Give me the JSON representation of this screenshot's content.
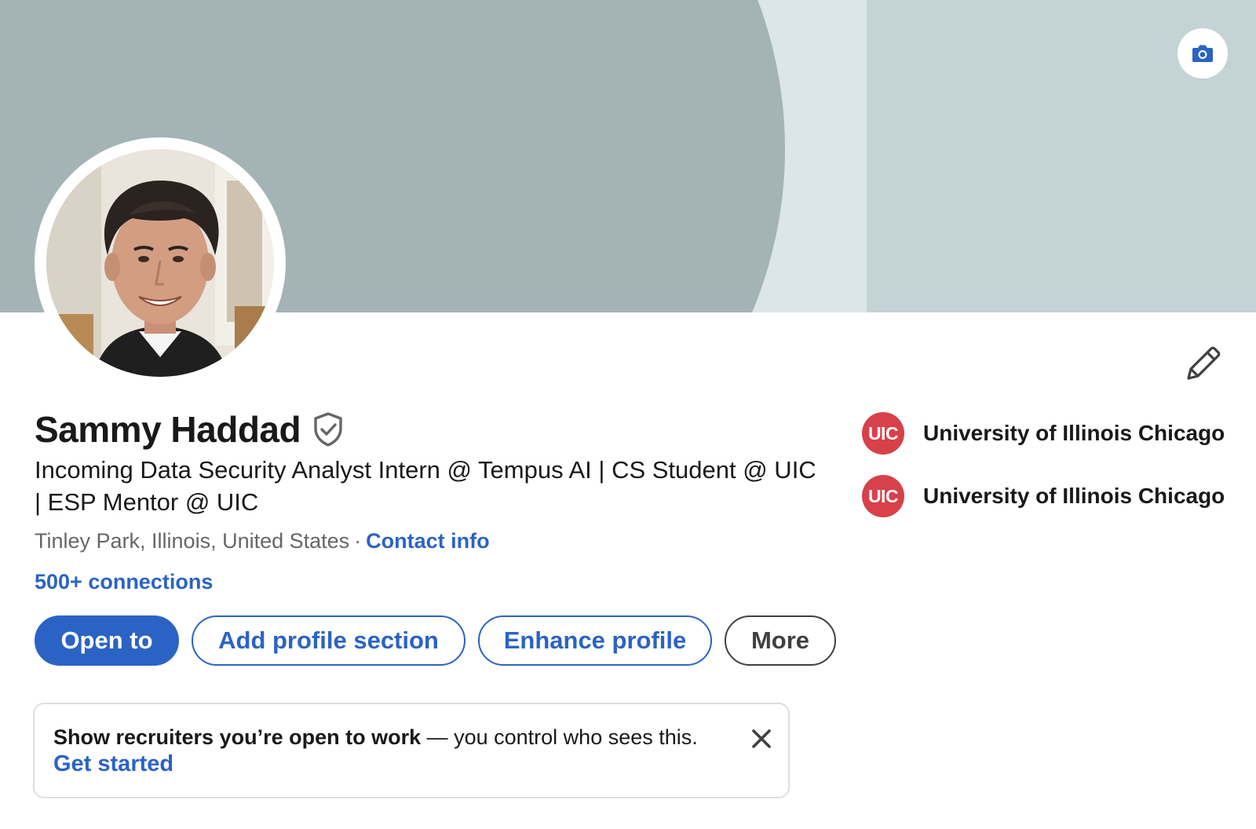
{
  "profile": {
    "name": "Sammy Haddad",
    "headline": "Incoming Data Security Analyst Intern @ Tempus AI | CS Student @ UIC | ESP Mentor @ UIC",
    "location": "Tinley Park, Illinois, United States",
    "separator": "·",
    "contact_info_label": "Contact info",
    "connections_label": "500+ connections"
  },
  "actions": {
    "open_to": "Open to",
    "add_profile_section": "Add profile section",
    "enhance_profile": "Enhance profile",
    "more": "More"
  },
  "education": [
    {
      "logo_text": "UIC",
      "name": "University of Illinois Chicago"
    },
    {
      "logo_text": "UIC",
      "name": "University of Illinois Chicago"
    }
  ],
  "notice": {
    "bold_text": "Show recruiters you’re open to work",
    "rest_text": " — you control who sees this.",
    "link_label": "Get started"
  },
  "icons": {
    "banner_camera": "camera-icon",
    "edit_intro": "pencil-icon",
    "verified": "shield-check-icon",
    "dismiss": "close-icon"
  },
  "colors": {
    "accent": "#2b63c4",
    "uic_red": "#d8404a",
    "banner_left": "#a3b3b6",
    "banner_mid": "#dce5e8",
    "banner_right": "#c3d3d6"
  }
}
